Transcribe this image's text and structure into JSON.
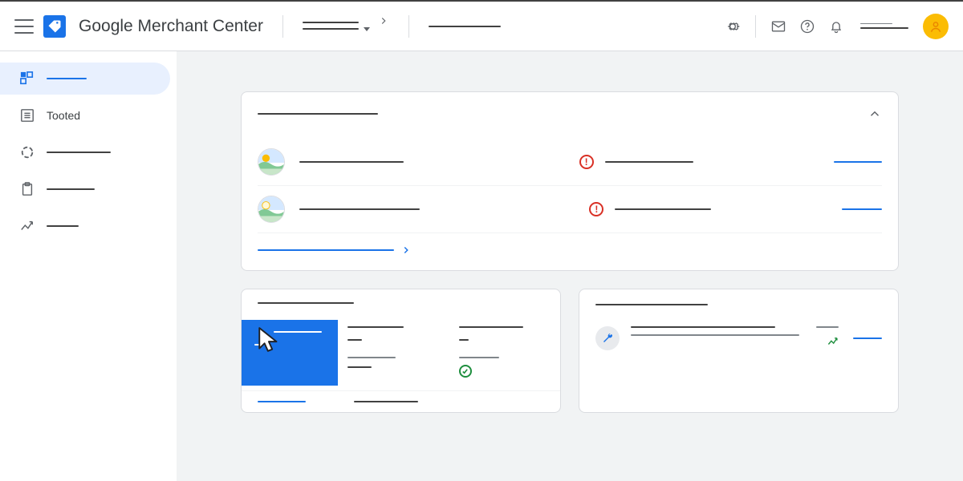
{
  "header": {
    "app_title": "Google Merchant Center",
    "account_breadcrumb": "",
    "account_child": "",
    "search_placeholder": ""
  },
  "sidebar": {
    "items": [
      {
        "label": "",
        "active": true
      },
      {
        "label": "Tooted",
        "active": false
      },
      {
        "label": "",
        "active": false
      },
      {
        "label": "",
        "active": false
      },
      {
        "label": "",
        "active": false
      }
    ]
  },
  "overview_card": {
    "title": "",
    "rows": [
      {
        "store": "",
        "status": "",
        "action": ""
      },
      {
        "store": "",
        "status": "",
        "action": ""
      }
    ],
    "footer_link": ""
  },
  "left_card": {
    "title": "",
    "tabs": [
      "",
      "",
      ""
    ],
    "footer_link": "",
    "footer_text": ""
  },
  "right_card": {
    "title": "",
    "item_title": "",
    "item_sub": "",
    "stat": "",
    "action": ""
  },
  "colors": {
    "primary": "#1a73e8",
    "danger": "#d93025",
    "success": "#1e8e3e",
    "accent": "#fbbc04"
  }
}
